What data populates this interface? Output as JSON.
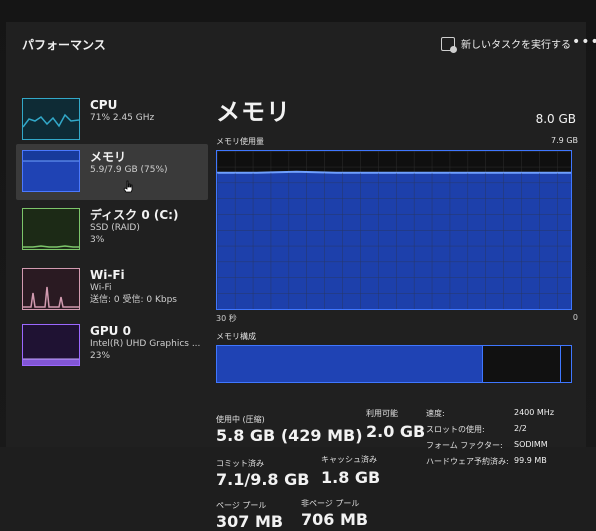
{
  "app": {
    "section_title": "パフォーマンス",
    "run_task_label": "新しいタスクを実行する",
    "more_label": "•••"
  },
  "sidebar": {
    "items": [
      {
        "id": "cpu",
        "title": "CPU",
        "sub": "71%  2.45 GHz",
        "selected": false
      },
      {
        "id": "memory",
        "title": "メモリ",
        "sub": "5.9/7.9 GB (75%)",
        "selected": true
      },
      {
        "id": "disk0",
        "title": "ディスク 0 (C:)",
        "sub1": "SSD (RAID)",
        "sub2": "3%",
        "selected": false
      },
      {
        "id": "wifi",
        "title": "Wi-Fi",
        "sub1": "Wi-Fi",
        "sub2": "送信: 0  受信: 0 Kbps",
        "selected": false
      },
      {
        "id": "gpu0",
        "title": "GPU 0",
        "sub1": "Intel(R) UHD Graphics ...",
        "sub2": "23%",
        "selected": false
      }
    ]
  },
  "main": {
    "title": "メモリ",
    "total": "8.0 GB",
    "usage_label": "メモリ使用量",
    "usage_max": "7.9 GB",
    "time_left": "30 秒",
    "time_right": "0",
    "composition_label": "メモリ構成",
    "composition": {
      "used_fraction": 0.75,
      "standby_fraction": 0.22,
      "free_fraction": 0.03
    },
    "stats": {
      "in_use_label": "使用中 (圧縮)",
      "in_use_value": "5.8 GB (429 MB)",
      "available_label": "利用可能",
      "available_value": "2.0 GB",
      "committed_label": "コミット済み",
      "committed_value": "7.1/9.8 GB",
      "cached_label": "キャッシュ済み",
      "cached_value": "1.8 GB",
      "paged_pool_label": "ページ プール",
      "paged_pool_value": "307 MB",
      "nonpaged_pool_label": "非ページ プール",
      "nonpaged_pool_value": "706 MB"
    },
    "specs": {
      "speed_label": "速度:",
      "speed_value": "2400 MHz",
      "slots_label": "スロットの使用:",
      "slots_value": "2/2",
      "form_factor_label": "フォーム ファクター:",
      "form_factor_value": "SODIMM",
      "hw_reserved_label": "ハードウェア予約済み:",
      "hw_reserved_value": "99.9 MB"
    }
  },
  "colors": {
    "accent_blue": "#3f77ff",
    "fill_blue": "#1f43b4",
    "cpu": "#32a8c8",
    "disk": "#7cc56a",
    "wifi": "#d29ab0",
    "gpu": "#9b68ff"
  },
  "icons": {
    "run_task": "run-task-icon",
    "more": "more-icon",
    "cursor": "hand-cursor-icon"
  }
}
